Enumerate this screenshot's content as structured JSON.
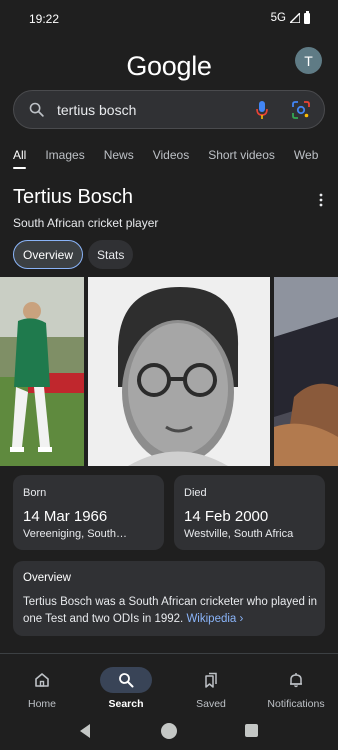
{
  "status_bar": {
    "time": "19:22",
    "network": "5G"
  },
  "header": {
    "logo": "Google",
    "avatar_letter": "T"
  },
  "search": {
    "query": "tertius bosch"
  },
  "tabs": [
    "All",
    "Images",
    "News",
    "Videos",
    "Short videos",
    "Web"
  ],
  "entity": {
    "title": "Tertius Bosch",
    "subtitle": "South African cricket player",
    "chips": [
      "Overview",
      "Stats"
    ]
  },
  "facts": {
    "born": {
      "label": "Born",
      "date": "14 Mar 1966",
      "place": "Vereeniging, South…"
    },
    "died": {
      "label": "Died",
      "date": "14 Feb 2000",
      "place": "Westville, South Africa"
    }
  },
  "overview": {
    "label": "Overview",
    "text": "Tertius Bosch was a South African cricketer who played in one Test and two ODIs in 1992. ",
    "link": "Wikipedia ›"
  },
  "bottom_nav": [
    "Home",
    "Search",
    "Saved",
    "Notifications"
  ],
  "colors": {
    "background": "#1f1f1f",
    "card": "#303134",
    "link": "#8ab4f8",
    "nav_active": "#394457"
  }
}
